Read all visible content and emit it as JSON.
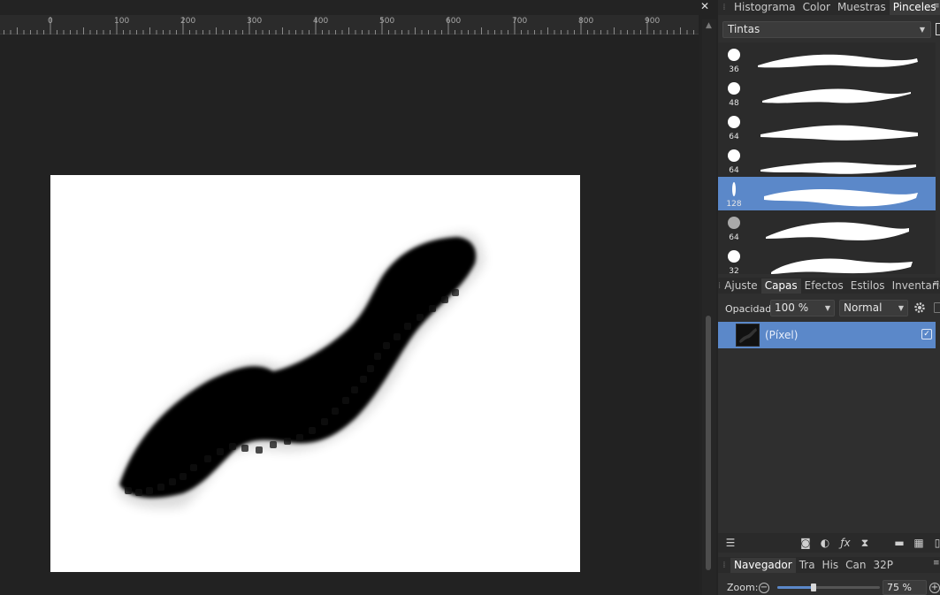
{
  "ruler": {
    "labels": [
      "0",
      "100",
      "200",
      "300",
      "400",
      "500",
      "600",
      "700",
      "800",
      "900"
    ]
  },
  "document": {
    "close_glyph": "✕"
  },
  "brushes_panel": {
    "tabs": [
      {
        "label": "Histograma",
        "active": false
      },
      {
        "label": "Color",
        "active": false
      },
      {
        "label": "Muestras",
        "active": false
      },
      {
        "label": "Pinceles",
        "active": true
      }
    ],
    "category": "Tintas",
    "items": [
      {
        "size": "36",
        "selected": false
      },
      {
        "size": "48",
        "selected": false
      },
      {
        "size": "64",
        "selected": false
      },
      {
        "size": "64",
        "selected": false
      },
      {
        "size": "128",
        "selected": true
      },
      {
        "size": "64",
        "selected": false
      },
      {
        "size": "32",
        "selected": false
      }
    ]
  },
  "layers_panel": {
    "tabs": [
      {
        "label": "Ajuste",
        "active": false
      },
      {
        "label": "Capas",
        "active": true
      },
      {
        "label": "Efectos",
        "active": false
      },
      {
        "label": "Estilos",
        "active": false
      },
      {
        "label": "Inventario",
        "active": false
      }
    ],
    "opacity_label": "Opacidad:",
    "opacity_value": "100 %",
    "blend_mode": "Normal",
    "layers": [
      {
        "name": "(Píxel)",
        "visible": true,
        "selected": true
      }
    ],
    "toolbar_icons": [
      "layers-stack-icon",
      "mask-icon",
      "adjustment-icon",
      "fx-icon",
      "hourglass-icon",
      "folder-icon",
      "checker-icon",
      "trash-icon"
    ]
  },
  "navigator_panel": {
    "tabs": [
      {
        "label": "Navegador",
        "active": true
      },
      {
        "label": "Tra",
        "active": false
      },
      {
        "label": "His",
        "active": false
      },
      {
        "label": "Can",
        "active": false
      },
      {
        "label": "32P",
        "active": false
      }
    ],
    "zoom_label": "Zoom:",
    "zoom_value": "75 %",
    "zoom_level": 0.35
  },
  "colors": {
    "accent": "#5b88c9",
    "panel_bg": "#2f2f2f",
    "canvas_bg": "#222222"
  }
}
